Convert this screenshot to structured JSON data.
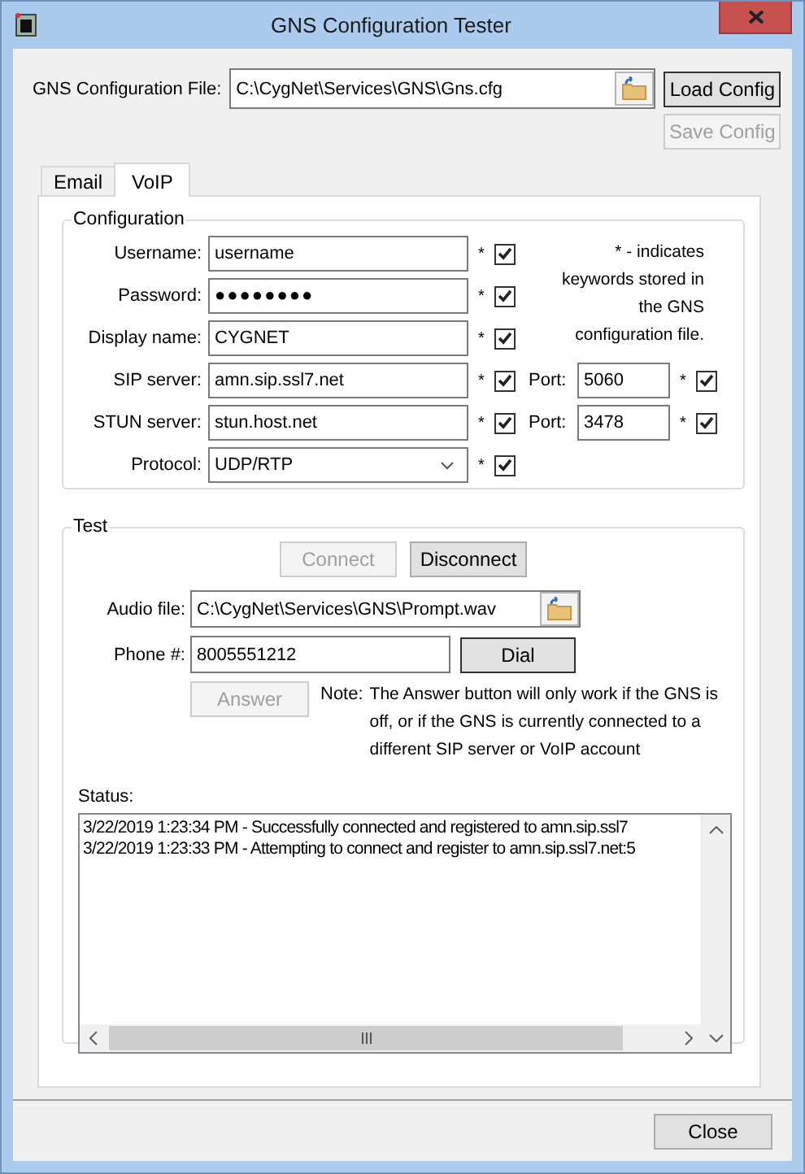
{
  "window": {
    "title": "GNS Configuration Tester"
  },
  "config_file": {
    "label": "GNS Configuration File:",
    "value": "C:\\CygNet\\Services\\GNS\\Gns.cfg",
    "load_button": {
      "label": "Load Config",
      "disabled": false
    },
    "save_button": {
      "label": "Save Config",
      "disabled": true
    }
  },
  "tabs": [
    {
      "label": "Email",
      "selected": false
    },
    {
      "label": "VoIP",
      "selected": true
    }
  ],
  "configuration": {
    "title": "Configuration",
    "rows": [
      {
        "label": "Username:",
        "value": "username",
        "kind": "text",
        "marker": "*",
        "checked": true
      },
      {
        "label": "Password:",
        "value": "●●●●●●●●",
        "kind": "password",
        "marker": "*",
        "checked": true
      },
      {
        "label": "Display name:",
        "value": "CYGNET",
        "kind": "text",
        "marker": "*",
        "checked": true
      },
      {
        "label": "SIP server:",
        "value": "amn.sip.ssl7.net",
        "kind": "text",
        "marker": "*",
        "checked": true,
        "port": {
          "label": "Port:",
          "value": "5060",
          "marker": "*",
          "checked": true
        }
      },
      {
        "label": "STUN server:",
        "value": "stun.host.net",
        "kind": "text",
        "marker": "*",
        "checked": true,
        "port": {
          "label": "Port:",
          "value": "3478",
          "marker": "*",
          "checked": true
        }
      },
      {
        "label": "Protocol:",
        "value": "UDP/RTP",
        "kind": "dropdown",
        "marker": "*",
        "checked": true
      }
    ],
    "legend": "* - indicates keywords stored in the GNS configuration file."
  },
  "test": {
    "title": "Test",
    "connect_button": {
      "label": "Connect",
      "disabled": true
    },
    "disconnect_button": {
      "label": "Disconnect",
      "disabled": false
    },
    "audio_file": {
      "label": "Audio file:",
      "value": "C:\\CygNet\\Services\\GNS\\Prompt.wav"
    },
    "phone": {
      "label": "Phone #:",
      "value": "8005551212"
    },
    "dial_button": {
      "label": "Dial",
      "disabled": false
    },
    "answer_button": {
      "label": "Answer",
      "disabled": true
    },
    "note": {
      "label": "Note:",
      "text": "The Answer button will only work if the GNS is off, or if the GNS is currently connected to a different SIP server or VoIP account"
    },
    "status": {
      "label": "Status:",
      "lines": [
        "3/22/2019 1:23:34 PM - Successfully connected and registered to amn.sip.ssl7",
        "3/22/2019 1:23:33 PM - Attempting to connect and register to amn.sip.ssl7.net:5"
      ]
    }
  },
  "close_button": {
    "label": "Close",
    "disabled": false
  }
}
